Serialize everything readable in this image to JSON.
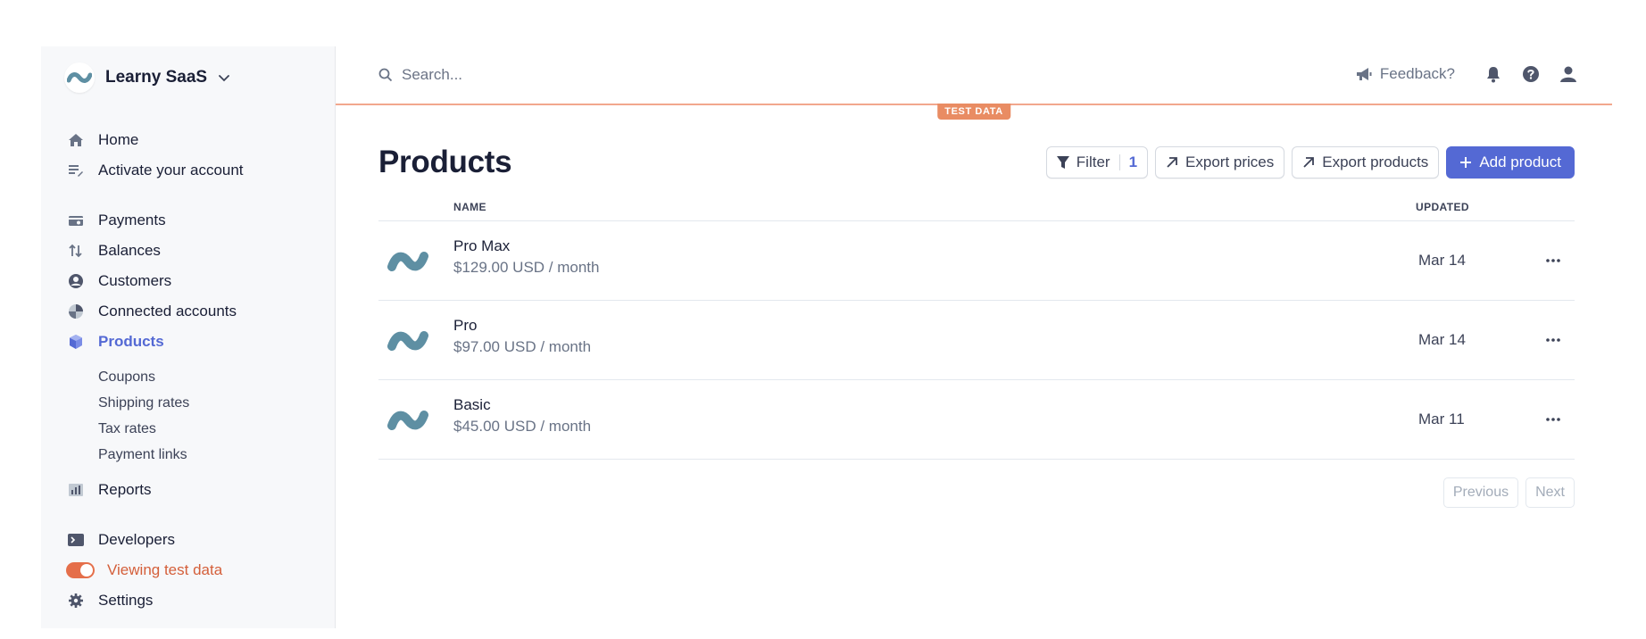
{
  "brand": {
    "name": "Learny SaaS"
  },
  "nav": {
    "home": "Home",
    "activate": "Activate your account",
    "payments": "Payments",
    "balances": "Balances",
    "customers": "Customers",
    "connected": "Connected accounts",
    "products": "Products",
    "sub": [
      "Coupons",
      "Shipping rates",
      "Tax rates",
      "Payment links"
    ],
    "reports": "Reports",
    "developers": "Developers",
    "test_mode": "Viewing test data",
    "settings": "Settings"
  },
  "topbar": {
    "search_placeholder": "Search...",
    "feedback": "Feedback?",
    "test_badge": "TEST DATA"
  },
  "page": {
    "title": "Products",
    "filter_label": "Filter",
    "filter_count": "1",
    "export_prices": "Export prices",
    "export_products": "Export products",
    "add_product": "Add product"
  },
  "table": {
    "col_name": "NAME",
    "col_updated": "UPDATED",
    "rows": [
      {
        "name": "Pro Max",
        "price": "$129.00 USD / month",
        "updated": "Mar 14"
      },
      {
        "name": "Pro",
        "price": "$97.00 USD / month",
        "updated": "Mar 14"
      },
      {
        "name": "Basic",
        "price": "$45.00 USD / month",
        "updated": "Mar 11"
      }
    ]
  },
  "pager": {
    "prev": "Previous",
    "next": "Next"
  },
  "colors": {
    "accent": "#5469d4",
    "test": "#e56f4a",
    "logo": "#5e8fa3"
  }
}
